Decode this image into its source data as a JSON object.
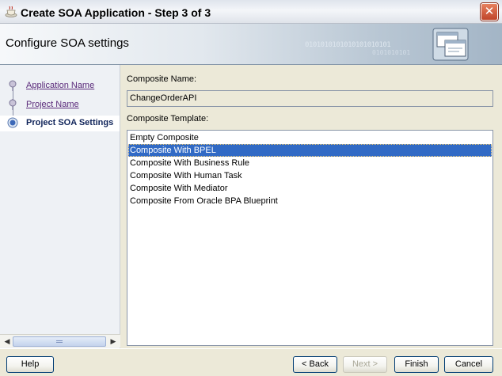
{
  "window": {
    "title": "Create SOA Application - Step 3 of 3",
    "close_glyph": "✕"
  },
  "header": {
    "title": "Configure SOA settings",
    "watermark_line1": "0101010101010101010101",
    "watermark_line2": "0101010101"
  },
  "nav": {
    "items": [
      {
        "label": "Application Name",
        "state": "visited"
      },
      {
        "label": "Project Name",
        "state": "visited"
      },
      {
        "label": "Project SOA Settings",
        "state": "current"
      }
    ]
  },
  "form": {
    "composite_name_label": "Composite Name:",
    "composite_name_value": "ChangeOrderAPI",
    "composite_template_label": "Composite Template:",
    "templates": [
      "Empty Composite",
      "Composite With BPEL",
      "Composite With Business Rule",
      "Composite With Human Task",
      "Composite With Mediator",
      "Composite From Oracle BPA Blueprint"
    ],
    "selected_template": "Composite With BPEL"
  },
  "buttons": {
    "help": "Help",
    "back": "< Back",
    "next": "Next >",
    "finish": "Finish",
    "cancel": "Cancel"
  },
  "colors": {
    "selection": "#316ac5",
    "link_visited": "#5a2a7a",
    "current_step": "#10245a"
  }
}
